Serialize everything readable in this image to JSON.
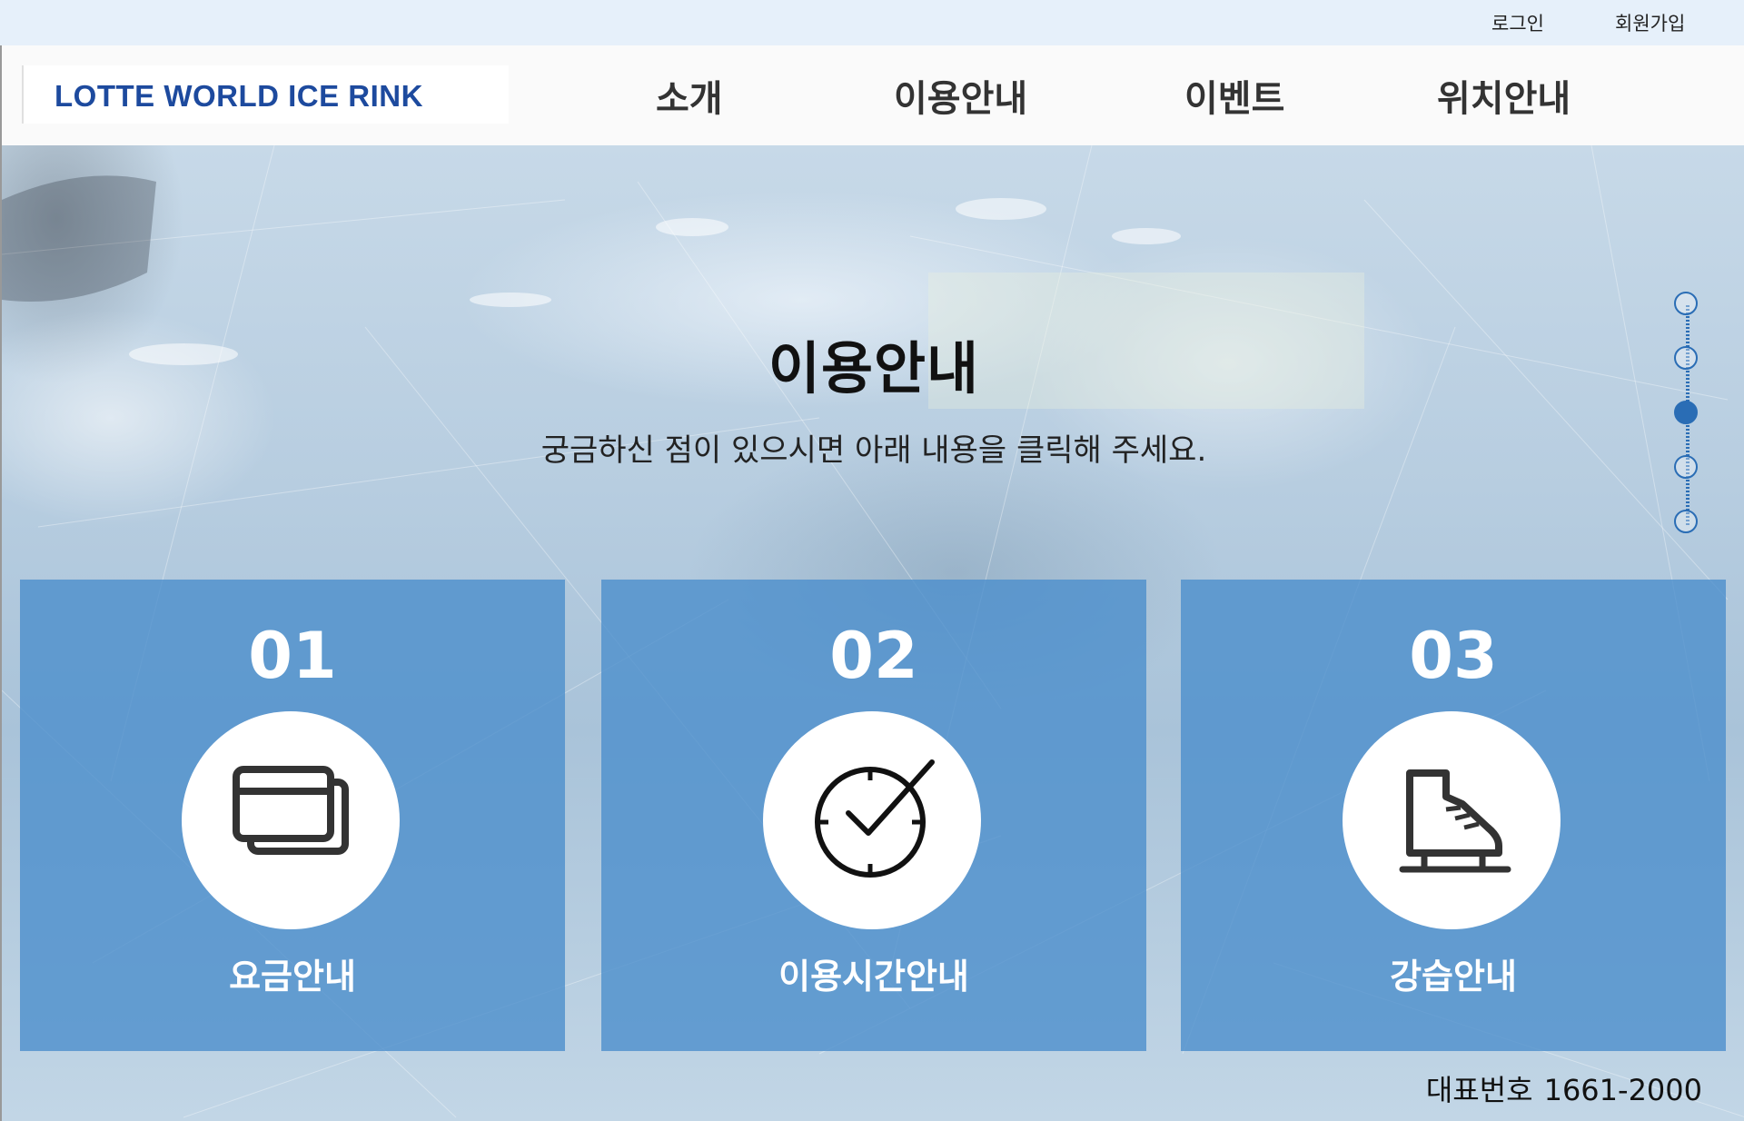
{
  "topbar": {
    "login": "로그인",
    "signup": "회원가입"
  },
  "header": {
    "logo": "LOTTE WORLD  ICE RINK",
    "nav": [
      "소개",
      "이용안내",
      "이벤트",
      "위치안내"
    ]
  },
  "hero": {
    "title": "이용안내",
    "subtitle": "궁금하신 점이 있으시면 아래 내용을 클릭해 주세요."
  },
  "pager": {
    "count": 5,
    "active_index": 3
  },
  "cards": [
    {
      "number": "01",
      "label": "요금안내",
      "icon": "card-icon"
    },
    {
      "number": "02",
      "label": "이용시간안내",
      "icon": "clock-check-icon"
    },
    {
      "number": "03",
      "label": "강습안내",
      "icon": "skate-icon"
    }
  ],
  "footer": {
    "phone_label": "대표번호",
    "phone_number": "1661-2000"
  },
  "colors": {
    "brand_blue": "#1d4a9e",
    "card_blue": "#4c8fcc",
    "pager_blue": "#2a6db5",
    "topbar_bg": "#e6f0fa"
  }
}
